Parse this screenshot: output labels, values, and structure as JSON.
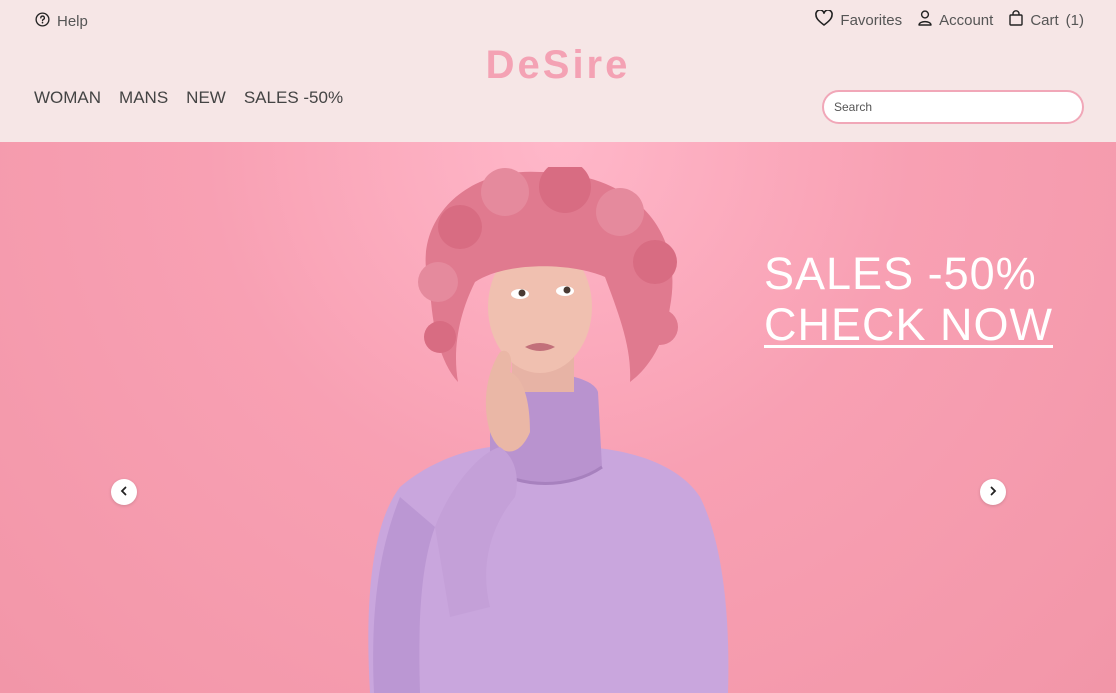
{
  "header": {
    "help_label": "Help",
    "favorites_label": "Favorites",
    "account_label": "Account",
    "cart_label": "Cart",
    "cart_count": "(1)",
    "logo": "DeSire",
    "search_placeholder": "Search"
  },
  "nav": {
    "items": [
      {
        "label": "WOMAN"
      },
      {
        "label": "MANS"
      },
      {
        "label": "NEW"
      },
      {
        "label": "SALES -50%"
      }
    ]
  },
  "hero": {
    "headline": "SALES -50%",
    "cta": "CHECK NOW"
  },
  "colors": {
    "header_bg": "#f6e6e6",
    "accent": "#f4a2b4",
    "hero_bg": "#f8a0b3",
    "sweater": "#c9a6dd",
    "hair": "#e07a8f"
  },
  "icons": [
    "help-circle-icon",
    "heart-icon",
    "user-icon",
    "shopping-bag-icon",
    "chevron-left-icon",
    "chevron-right-icon"
  ]
}
